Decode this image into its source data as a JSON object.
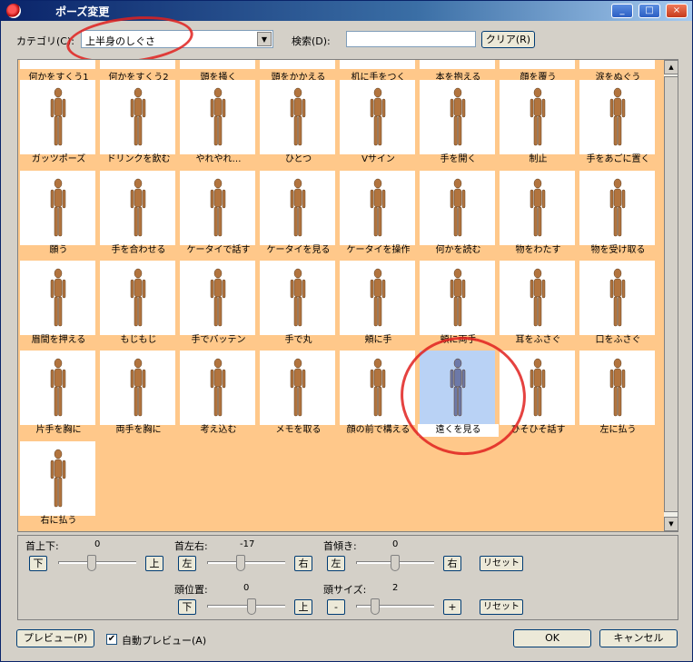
{
  "window": {
    "title": "ポーズ変更",
    "controls": [
      "_",
      "□",
      "×"
    ]
  },
  "toolbar": {
    "category_label": "カテゴリ(C):",
    "category_value": "上半身のしぐさ",
    "search_label": "検索(D):",
    "search_value": "",
    "clear_label": "クリア(R)"
  },
  "poses": [
    "何かをすくう1",
    "何かをすくう2",
    "頭を掻く",
    "頭をかかえる",
    "机に手をつく",
    "本を抱える",
    "顔を覆う",
    "涙をぬぐう",
    "ガッツポーズ",
    "ドリンクを飲む",
    "やれやれ…",
    "ひとつ",
    "Vサイン",
    "手を開く",
    "制止",
    "手をあごに置く",
    "願う",
    "手を合わせる",
    "ケータイで話す",
    "ケータイを見る",
    "ケータイを操作",
    "何かを読む",
    "物をわたす",
    "物を受け取る",
    "眉間を押える",
    "もじもじ",
    "手でバッテン",
    "手で丸",
    "頬に手",
    "頬に両手",
    "耳をふさぐ",
    "口をふさぐ",
    "片手を胸に",
    "両手を胸に",
    "考え込む",
    "メモを取る",
    "顔の前で構える",
    "遠くを見る",
    "ひそひそ話す",
    "左に払う",
    "右に払う"
  ],
  "selected_pose": "遠くを見る",
  "controls": {
    "neck_updown": {
      "label": "首上下:",
      "value": "0",
      "left": "下",
      "right": "上"
    },
    "neck_lr": {
      "label": "首左右:",
      "value": "-17",
      "left": "左",
      "right": "右"
    },
    "neck_tilt": {
      "label": "首傾き:",
      "value": "0",
      "left": "左",
      "right": "右"
    },
    "head_pos": {
      "label": "頭位置:",
      "value": "0",
      "left": "下",
      "right": "上"
    },
    "head_size": {
      "label": "頭サイズ:",
      "value": "2",
      "left": "-",
      "right": "+"
    },
    "reset": "リセット"
  },
  "footer": {
    "preview": "プレビュー(P)",
    "auto_preview": "自動プレビュー(A)",
    "auto_preview_checked": "✔",
    "ok": "OK",
    "cancel": "キャンセル"
  },
  "colors": {
    "grid_bg": "#ffc88a",
    "selected": "#b9d2f5",
    "annotation": "#e0211f"
  }
}
